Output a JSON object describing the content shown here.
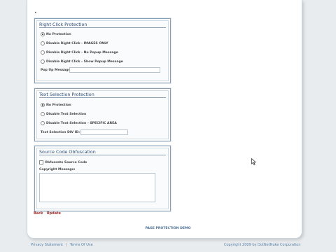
{
  "top_marker": "•",
  "right_click": {
    "title": "Right Click Protection",
    "options": [
      {
        "label": "No Protection",
        "selected": true
      },
      {
        "label": "Disable Right Click - IMAGES ONLY",
        "selected": false
      },
      {
        "label": "Disable Right Click - No Popup Message",
        "selected": false
      },
      {
        "label": "Disable Right Click - Show Popup Message",
        "selected": false
      }
    ],
    "popup_label": "Pop Up Message :",
    "popup_value": ""
  },
  "text_selection": {
    "title": "Text Selection Protection",
    "options": [
      {
        "label": "No Protection",
        "selected": true
      },
      {
        "label": "Disable Text Selection",
        "selected": false
      },
      {
        "label": "Disable Text Selection - SPECIFIC AREA",
        "selected": false
      }
    ],
    "div_label": "Text Selection DIV ID:",
    "div_value": ""
  },
  "source_code": {
    "title": "Source Code Obfuscation",
    "checkbox_label": "Obfuscate Source Code",
    "checked": false,
    "copyright_label": "Copyright Message:",
    "copyright_value": ""
  },
  "nav": {
    "back": "Back",
    "update": "Update"
  },
  "demo_title": "PAGE PROTECTION DEMO",
  "footer": {
    "privacy": "Privacy Statement",
    "separator": "|",
    "terms": "Terms Of Use",
    "copyright": "Copyright 2009 by DotNetNuke Corporation"
  },
  "colors": {
    "accent": "#2f4f73",
    "link_red": "#a03030",
    "footer_link": "#5a7fa6"
  }
}
